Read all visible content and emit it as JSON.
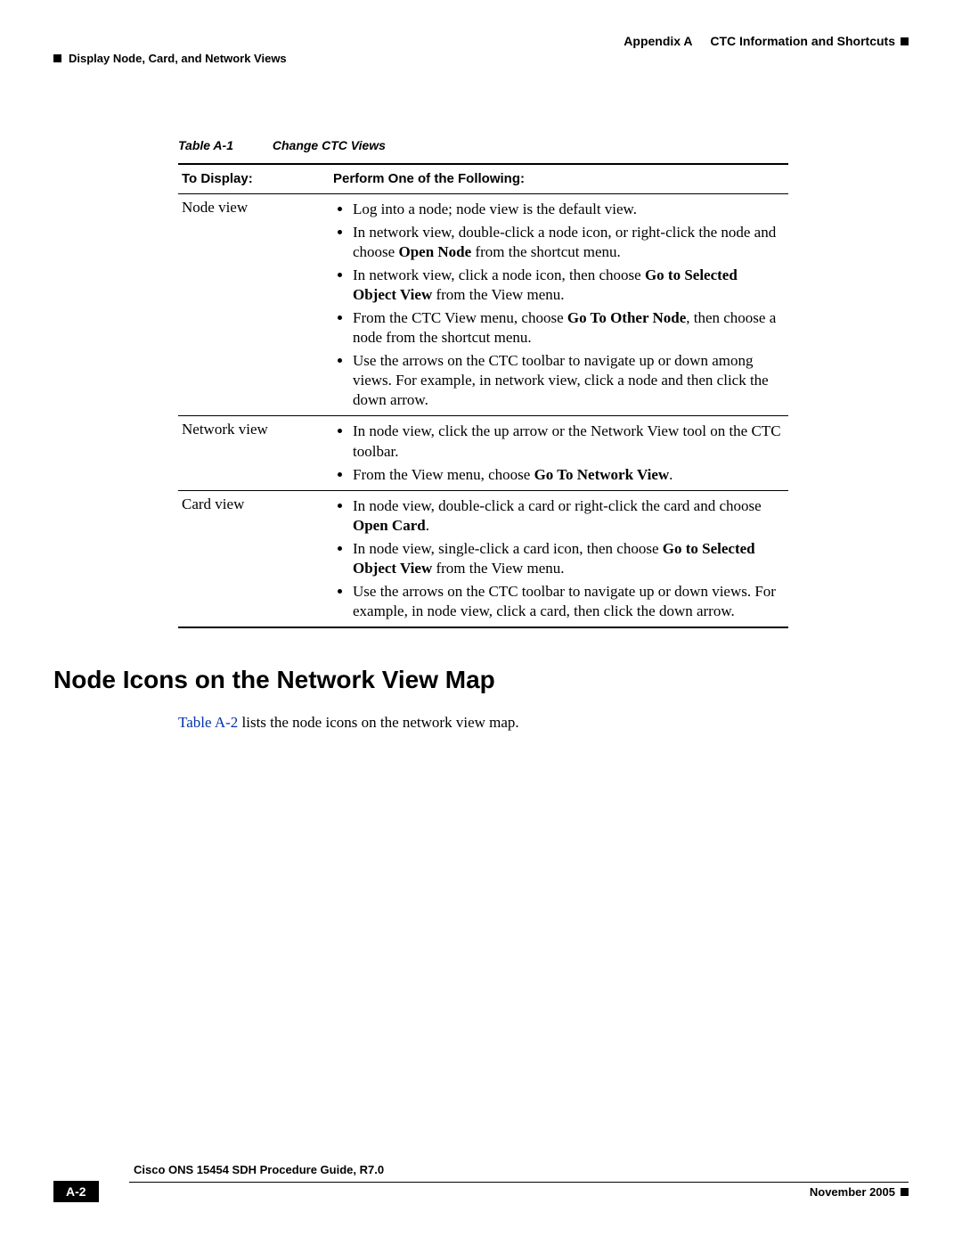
{
  "header": {
    "appendix_label": "Appendix A",
    "appendix_title": "CTC Information and Shortcuts",
    "section_path": "Display Node, Card, and Network Views"
  },
  "table": {
    "number": "Table A-1",
    "title": "Change CTC Views",
    "columns": [
      "To Display:",
      "Perform One of the Following:"
    ],
    "rows": [
      {
        "label": "Node view",
        "items": [
          [
            {
              "t": "Log into a node; node view is the default view."
            }
          ],
          [
            {
              "t": "In network view, double-click a node icon, or right-click the node and choose "
            },
            {
              "b": "Open Node"
            },
            {
              "t": " from the shortcut menu."
            }
          ],
          [
            {
              "t": "In network view, click a node icon, then choose "
            },
            {
              "b": "Go to Selected Object View"
            },
            {
              "t": " from the View menu."
            }
          ],
          [
            {
              "t": "From the CTC View menu, choose "
            },
            {
              "b": "Go To Other Node"
            },
            {
              "t": ", then choose a node from the shortcut menu."
            }
          ],
          [
            {
              "t": "Use the arrows on the CTC toolbar to navigate up or down among views. For example, in network view, click a node and then click the down arrow."
            }
          ]
        ]
      },
      {
        "label": "Network view",
        "items": [
          [
            {
              "t": "In node view, click the up arrow or the Network View tool on the CTC toolbar."
            }
          ],
          [
            {
              "t": "From the View menu, choose "
            },
            {
              "b": "Go To Network View"
            },
            {
              "t": "."
            }
          ]
        ]
      },
      {
        "label": "Card view",
        "items": [
          [
            {
              "t": "In node view, double-click a card or right-click the card and choose "
            },
            {
              "b": "Open Card"
            },
            {
              "t": "."
            }
          ],
          [
            {
              "t": "In node view, single-click a card icon, then choose "
            },
            {
              "b": "Go to Selected Object View"
            },
            {
              "t": " from the View menu."
            }
          ],
          [
            {
              "t": "Use the arrows on the CTC toolbar to navigate up or down views. For example, in node view, click a card, then click the down arrow."
            }
          ]
        ]
      }
    ]
  },
  "section": {
    "heading": "Node Icons on the Network View Map",
    "table_ref": "Table A-2",
    "text_after_ref": " lists the node icons on the network view map."
  },
  "footer": {
    "doc_title": "Cisco ONS 15454 SDH Procedure Guide, R7.0",
    "page_number": "A-2",
    "date": "November 2005"
  }
}
